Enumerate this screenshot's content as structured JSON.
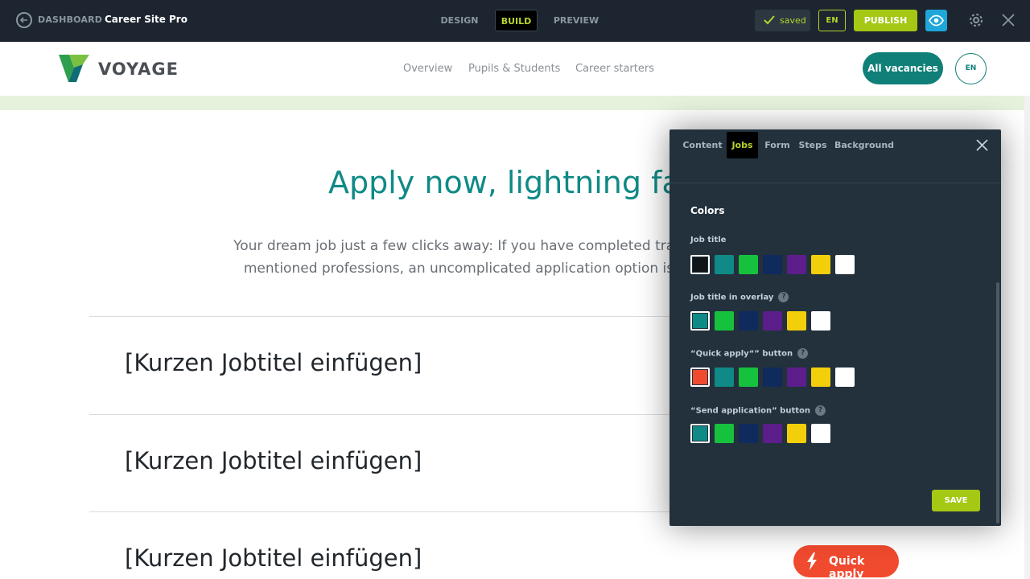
{
  "topbar": {
    "dashboard_label": "DASHBOARD",
    "site_name": "Career Site Pro",
    "tabs": [
      "DESIGN",
      "BUILD",
      "PREVIEW"
    ],
    "saved_label": "saved",
    "lang_label": "EN",
    "publish_label": "PUBLISH"
  },
  "site": {
    "brand": "VOYAGE",
    "nav": [
      "Overview",
      "Pupils & Students",
      "Career starters"
    ],
    "cta_label": "All vacancies",
    "lang_label": "EN"
  },
  "main": {
    "headline": "Apply now, lightning fas",
    "intro_line1": "Your dream job just a few clicks away: If you have completed trair",
    "intro_line2": "mentioned professions, an uncomplicated application option is",
    "job_titles": [
      "[Kurzen Jobtitel einfügen]",
      "[Kurzen Jobtitel einfügen]",
      "[Kurzen Jobtitel einfügen]"
    ],
    "quick_apply_label": "Quick apply"
  },
  "panel": {
    "tabs": [
      "Content",
      "Jobs",
      "Form",
      "Steps",
      "Background"
    ],
    "active_tab": "Jobs",
    "section_title": "Colors",
    "groups": [
      {
        "label": "Job title",
        "help": false,
        "colors": [
          "#0f1419",
          "#0f8a86",
          "#16c13e",
          "#0f2a5c",
          "#5c1e8a",
          "#f2cf0a",
          "#ffffff"
        ],
        "selected": 0
      },
      {
        "label": "Job title in overlay",
        "help": true,
        "colors": [
          "#0f8a86",
          "#16c13e",
          "#0f2a5c",
          "#5c1e8a",
          "#f2cf0a",
          "#ffffff"
        ],
        "selected": 0
      },
      {
        "label": "“Quick apply“” button",
        "help": true,
        "colors": [
          "#f04a2f",
          "#0f8a86",
          "#16c13e",
          "#0f2a5c",
          "#5c1e8a",
          "#f2cf0a",
          "#ffffff"
        ],
        "selected": 0
      },
      {
        "label": "“Send application” button",
        "help": true,
        "colors": [
          "#0f8a86",
          "#16c13e",
          "#0f2a5c",
          "#5c1e8a",
          "#f2cf0a",
          "#ffffff"
        ],
        "selected": 0
      }
    ],
    "help_glyph": "?",
    "save_label": "SAVE"
  }
}
